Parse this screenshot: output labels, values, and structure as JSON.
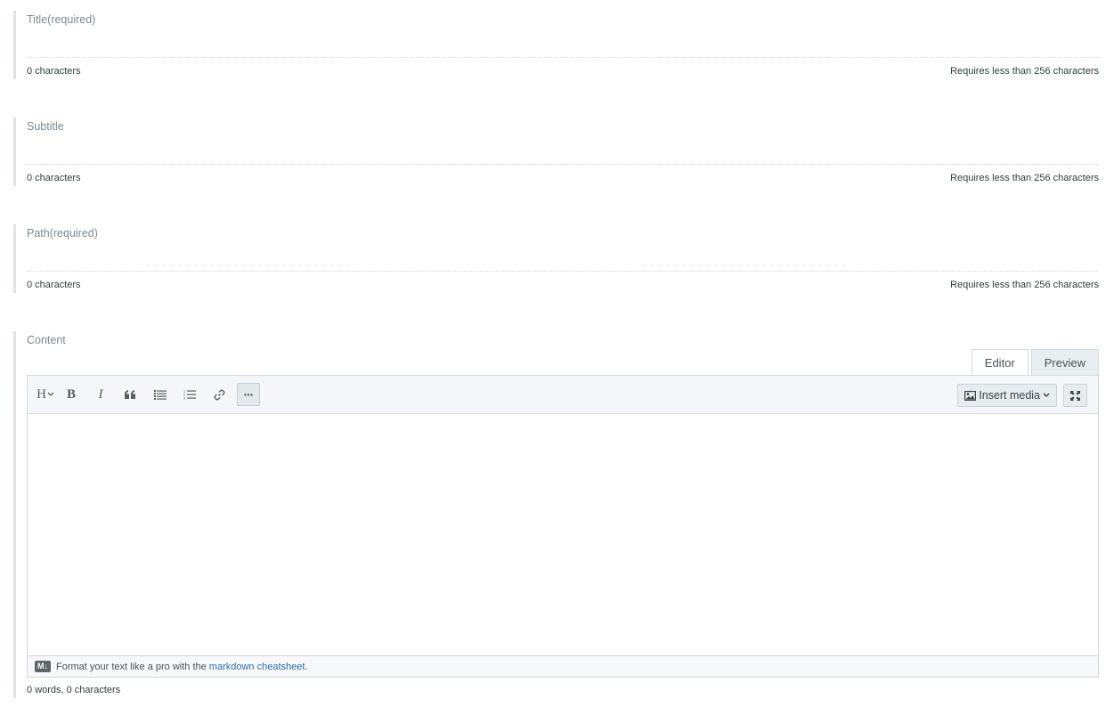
{
  "fields": {
    "title": {
      "label": "Title(required)",
      "value": "",
      "count": "0 characters",
      "limit": "Requires less than 256 characters"
    },
    "subtitle": {
      "label": "Subtitle",
      "value": "",
      "count": "0 characters",
      "limit": "Requires less than 256 characters"
    },
    "path": {
      "label": "Path(required)",
      "value": "",
      "count": "0 characters",
      "limit": "Requires less than 256 characters"
    }
  },
  "content": {
    "label": "Content",
    "tabs": [
      {
        "label": "Editor",
        "active": true
      },
      {
        "label": "Preview",
        "active": false
      }
    ],
    "toolbar": {
      "heading_label": "H",
      "bold_label": "B",
      "italic_label": "I",
      "insert_media_label": "Insert media"
    },
    "footer": {
      "badge": "M↓",
      "text_before": "Format your text like a pro with the",
      "link_text": "markdown cheatsheet",
      "text_after": "."
    },
    "word_count": "0 words, 0 characters"
  },
  "icons": {
    "heading": "heading-icon",
    "bold": "bold-icon",
    "italic": "italic-icon",
    "quote": "quote-icon",
    "unordered_list": "unordered-list-icon",
    "ordered_list": "ordered-list-icon",
    "link": "link-icon",
    "more": "more-icon",
    "image": "image-icon",
    "fullscreen": "fullscreen-icon"
  },
  "colors": {
    "accent_link": "#2c6fa8",
    "field_border": "#dfe3e4",
    "label": "#7a8a93"
  }
}
